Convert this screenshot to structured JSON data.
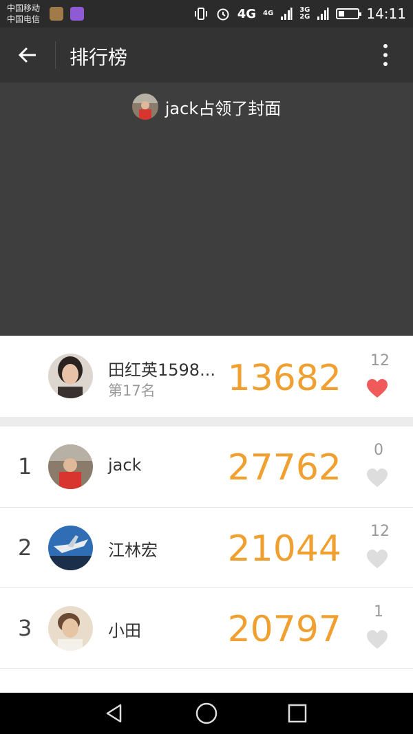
{
  "status_bar": {
    "carrier_1": "中国移动",
    "carrier_2": "中国电信",
    "network_4g": "4G",
    "network_4g_small": "4G",
    "network_3g": "3G",
    "network_2g": "2G",
    "time": "14:11",
    "icons": [
      "vibrate-icon",
      "alarm-icon",
      "signal-icon",
      "battery-icon"
    ]
  },
  "toolbar": {
    "title": "排行榜",
    "back_icon": "arrow-left-icon",
    "menu_icon": "more-vertical-icon"
  },
  "cover": {
    "text": "jack占领了封面"
  },
  "my_rank": {
    "name": "田红英1598...",
    "position_label": "第17名",
    "steps": "13682",
    "likes": "12",
    "liked": true
  },
  "ranking": [
    {
      "rank": "1",
      "name": "jack",
      "steps": "27762",
      "likes": "0",
      "liked": false
    },
    {
      "rank": "2",
      "name": "江林宏",
      "steps": "21044",
      "likes": "12",
      "liked": false
    },
    {
      "rank": "3",
      "name": "小田",
      "steps": "20797",
      "likes": "1",
      "liked": false
    }
  ],
  "colors": {
    "score": "#f0a030",
    "heart_liked": "#f05a5a",
    "heart_unliked": "#dddddd",
    "toolbar_bg": "#333333",
    "cover_bg": "#3e3e3e"
  },
  "nav": {
    "back": "triangle-back-icon",
    "home": "circle-home-icon",
    "recents": "square-recents-icon"
  }
}
